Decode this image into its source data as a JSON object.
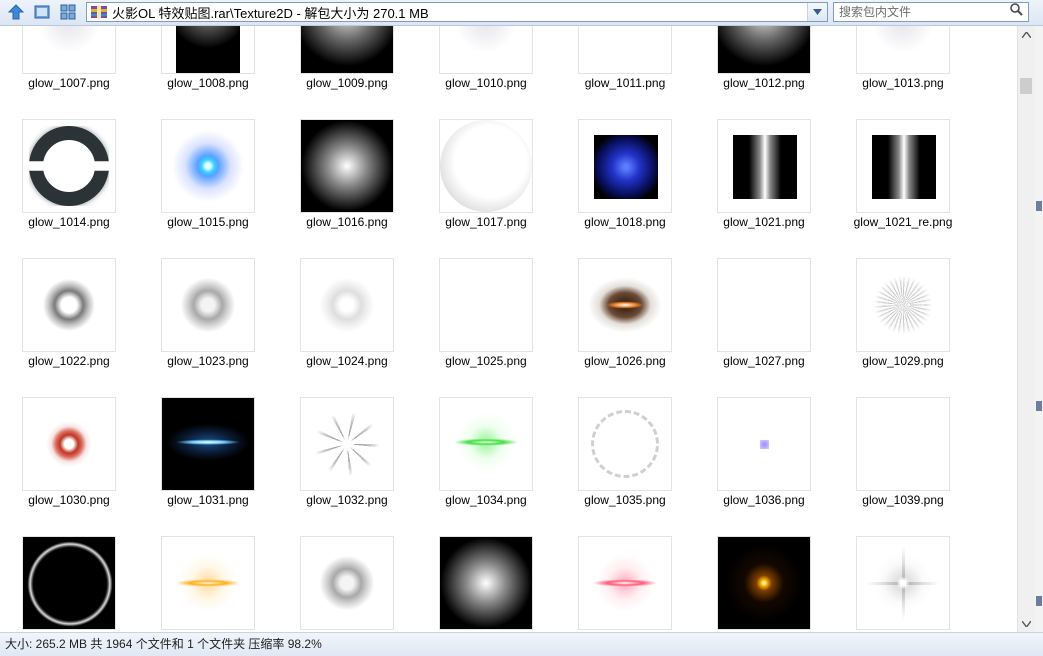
{
  "toolbar": {
    "address_path": "火影OL 特效贴图.rar\\Texture2D - 解包大小为 270.1 MB",
    "search_placeholder": "搜索包内文件",
    "icons": [
      "up-arrow-icon",
      "view-details-icon",
      "view-thumbnails-icon",
      "archive-icon",
      "chevron-down-icon",
      "search-icon"
    ]
  },
  "files": [
    {
      "name": "glow_1007.png",
      "kind": "light-faint"
    },
    {
      "name": "glow_1008.png",
      "kind": "dark-radial-small"
    },
    {
      "name": "glow_1009.png",
      "kind": "dark-radial"
    },
    {
      "name": "glow_1010.png",
      "kind": "light-faint"
    },
    {
      "name": "glow_1011.png",
      "kind": "blue-blob"
    },
    {
      "name": "glow_1012.png",
      "kind": "dark-radial"
    },
    {
      "name": "glow_1013.png",
      "kind": "light-faint"
    },
    {
      "name": "glow_1014.png",
      "kind": "ring-halves"
    },
    {
      "name": "glow_1015.png",
      "kind": "cyan-dot"
    },
    {
      "name": "glow_1016.png",
      "kind": "dark-radial-full"
    },
    {
      "name": "glow_1017.png",
      "kind": "white-sphere"
    },
    {
      "name": "glow_1018.png",
      "kind": "blue-square"
    },
    {
      "name": "glow_1021.png",
      "kind": "vertical-bar"
    },
    {
      "name": "glow_1021_re.png",
      "kind": "vertical-bar"
    },
    {
      "name": "glow_1022.png",
      "kind": "gray-ring"
    },
    {
      "name": "glow_1023.png",
      "kind": "gray-ring-soft"
    },
    {
      "name": "glow_1024.png",
      "kind": "faint-ring"
    },
    {
      "name": "glow_1025.png",
      "kind": "blank"
    },
    {
      "name": "glow_1026.png",
      "kind": "brown-flare"
    },
    {
      "name": "glow_1027.png",
      "kind": "blank"
    },
    {
      "name": "glow_1029.png",
      "kind": "gray-burst"
    },
    {
      "name": "glow_1030.png",
      "kind": "red-ring"
    },
    {
      "name": "glow_1031.png",
      "kind": "blue-streak-dark"
    },
    {
      "name": "glow_1032.png",
      "kind": "star-burst"
    },
    {
      "name": "glow_1034.png",
      "kind": "green-streak"
    },
    {
      "name": "glow_1035.png",
      "kind": "wispy-ring"
    },
    {
      "name": "glow_1036.png",
      "kind": "tiny-purple"
    },
    {
      "name": "glow_1039.png",
      "kind": "blank"
    },
    {
      "name": "",
      "kind": "dark-circle"
    },
    {
      "name": "",
      "kind": "orange-streak"
    },
    {
      "name": "",
      "kind": "gray-ring-soft"
    },
    {
      "name": "",
      "kind": "dark-radial-full"
    },
    {
      "name": "",
      "kind": "pink-streak"
    },
    {
      "name": "",
      "kind": "orange-dot-dark"
    },
    {
      "name": "",
      "kind": "sparkle-star"
    }
  ],
  "status": {
    "text": "大小: 265.2 MB 共 1964 个文件和 1 个文件夹 压缩率 98.2%"
  }
}
